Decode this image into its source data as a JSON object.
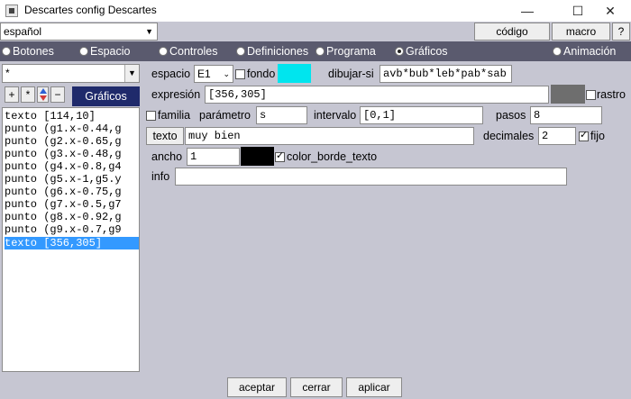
{
  "window": {
    "title": "Descartes config Descartes",
    "minimize": "—",
    "maximize": "☐",
    "close": "✕"
  },
  "top": {
    "language": "español",
    "codigo": "código",
    "macro": "macro",
    "help": "?"
  },
  "tabs": [
    {
      "label": "Botones",
      "selected": false
    },
    {
      "label": "Espacio",
      "selected": false
    },
    {
      "label": "Controles",
      "selected": false
    },
    {
      "label": "Definiciones",
      "selected": false
    },
    {
      "label": "Programa",
      "selected": false
    },
    {
      "label": "Gráficos",
      "selected": true
    },
    {
      "label": "Animación",
      "selected": false
    }
  ],
  "left": {
    "selector_value": "*",
    "btn_add": "+",
    "btn_star": "*",
    "btn_remove": "−",
    "section_label": "Gráficos",
    "items": [
      "texto [114,10]",
      "punto (g1.x-0.44,g",
      "punto (g2.x-0.65,g",
      "punto (g3.x-0.48,g",
      "punto (g4.x-0.8,g4",
      "punto (g5.x-1,g5.y",
      "punto (g6.x-0.75,g",
      "punto (g7.x-0.5,g7",
      "punto (g8.x-0.92,g",
      "punto (g9.x-0.7,g9",
      "texto [356,305]"
    ],
    "selected_index": 10
  },
  "form": {
    "espacio_label": "espacio",
    "espacio_value": "E1",
    "fondo_label": "fondo",
    "fondo_color": "#00e5ee",
    "dibujar_si_label": "dibujar-si",
    "dibujar_si_value": "avb*bub*leb*pab*sab",
    "expresion_label": "expresión",
    "expresion_value": "[356,305]",
    "expresion_color": "#6e6e6e",
    "rastro_label": "rastro",
    "familia_label": "familia",
    "parametro_label": "parámetro",
    "parametro_value": "s",
    "intervalo_label": "intervalo",
    "intervalo_value": "[0,1]",
    "pasos_label": "pasos",
    "pasos_value": "8",
    "texto_button": "texto",
    "texto_value": "muy bien",
    "decimales_label": "decimales",
    "decimales_value": "2",
    "fijo_label": "fijo",
    "fijo_checked": true,
    "ancho_label": "ancho",
    "ancho_value": "1",
    "ancho_color": "#000000",
    "color_borde_label": "color_borde_texto",
    "color_borde_checked": true,
    "info_label": "info",
    "info_value": ""
  },
  "bottom": {
    "aceptar": "aceptar",
    "cerrar": "cerrar",
    "aplicar": "aplicar"
  }
}
